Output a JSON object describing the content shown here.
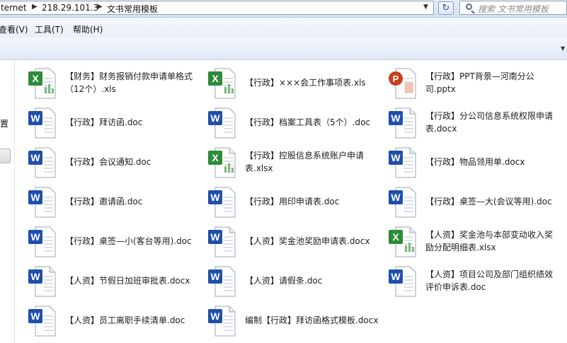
{
  "address_bar": {
    "segments": [
      "ternet",
      "218.29.101.3",
      "文书常用模板"
    ]
  },
  "search": {
    "placeholder": "搜索 文书常用模板"
  },
  "menu": {
    "items": [
      "查看(V)",
      "工具(T)",
      "帮助(H)"
    ]
  },
  "nav_pane": {
    "visible_text": "置"
  },
  "files": [
    {
      "name": "【财务】财务报销付款申请单格式（12个）.xls",
      "type": "excel"
    },
    {
      "name": "【行政】×××会工作事项表.xls",
      "type": "excel"
    },
    {
      "name": "【行政】PPT背景—河南分公司.pptx",
      "type": "powerpoint"
    },
    {
      "name": "【行政】拜访函.doc",
      "type": "word"
    },
    {
      "name": "【行政】档案工具表（5个）.doc",
      "type": "word"
    },
    {
      "name": "【行政】分公司信息系统权限申请表.docx",
      "type": "word-x"
    },
    {
      "name": "【行政】会议通知.doc",
      "type": "word"
    },
    {
      "name": "【行政】控股信息系统账户申请表.xlsx",
      "type": "excel-x"
    },
    {
      "name": "【行政】物品领用单.docx",
      "type": "word-x"
    },
    {
      "name": "【行政】邀请函.doc",
      "type": "word"
    },
    {
      "name": "【行政】用印申请表.doc",
      "type": "word"
    },
    {
      "name": "【行政】桌签—大(会议等用).doc",
      "type": "word"
    },
    {
      "name": "【行政】桌签—小(客台等用).doc",
      "type": "word"
    },
    {
      "name": "【人资】奖金池奖励申请表.docx",
      "type": "word-x"
    },
    {
      "name": "【人资】奖金池与本部变动收入奖励分配明细表.xlsx",
      "type": "excel-x"
    },
    {
      "name": "【人资】节假日加班审批表.docx",
      "type": "word-x"
    },
    {
      "name": "【人资】请假条.doc",
      "type": "word"
    },
    {
      "name": "【人资】项目公司及部门组织绩效评价申诉表.doc",
      "type": "word"
    },
    {
      "name": "【人资】员工离职手续清单.doc",
      "type": "word"
    },
    {
      "name": "编制【行政】拜访函格式模板.docx",
      "type": "word-x"
    }
  ],
  "colors": {
    "excel_green": "#2e8b3a",
    "word_blue": "#1f4fa8",
    "ppt_red": "#c8401e"
  }
}
